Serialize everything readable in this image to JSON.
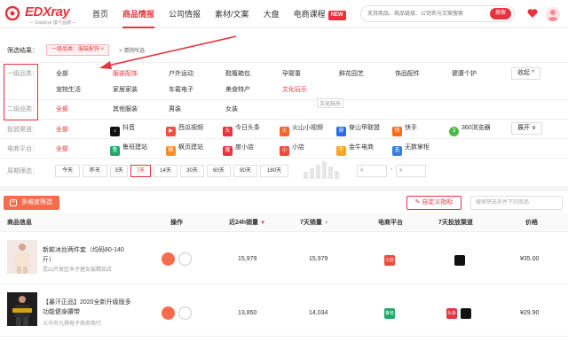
{
  "header": {
    "logo_text": "EDXray",
    "logo_sub": "— DataEye 旗下品牌 —",
    "nav": [
      {
        "label": "首页"
      },
      {
        "label": "商品情报"
      },
      {
        "label": "公司情报"
      },
      {
        "label": "素材/文案"
      },
      {
        "label": "大盘"
      },
      {
        "label": "电商课程"
      }
    ],
    "new_badge": "NEW",
    "search_placeholder": "支持商品、商品链接、公司名与文案搜索",
    "search_button": "搜索"
  },
  "result_bar": {
    "label": "筛选结果：",
    "tag": "一级品类：服装配饰 ×",
    "clear": "× 清除所选"
  },
  "filters": {
    "level1": {
      "label": "一级品类：",
      "row1": [
        "全部",
        "服装配饰",
        "户外运动",
        "鞋履箱包",
        "孕婴童",
        "鲜花园艺",
        "饰品配件",
        "健康个护"
      ],
      "row2": [
        "宠物生活",
        "家居家装",
        "车载电子",
        "美食特产",
        "文化玩乐"
      ],
      "collapse": "收起 ^"
    },
    "level2": {
      "label": "二级品类：",
      "options": [
        "全部",
        "其他服装",
        "男装",
        "女装"
      ],
      "tooltip": "文化玩乐"
    },
    "channel": {
      "label": "投放渠道：",
      "options": [
        "全部",
        "抖音",
        "西瓜视频",
        "今日头条",
        "火山小视频",
        "穿山甲联盟",
        "快手",
        "360浏览器"
      ],
      "expand": "展开 ∨"
    },
    "platform": {
      "label": "电商平台：",
      "options": [
        "全部",
        "鲁班建站",
        "枫页建站",
        "度小店",
        "小店",
        "金牛电商",
        "无数掌柜"
      ]
    },
    "period": {
      "label": "周期筛选：",
      "options": [
        "今天",
        "昨天",
        "3天",
        "7天",
        "14天",
        "30天",
        "60天",
        "90天",
        "180天"
      ],
      "price_symbol_1": "¥",
      "price_symbol_2": "¥",
      "dash": "-"
    }
  },
  "toolbar": {
    "multi_filter": "多维度筛选",
    "custom_metric": "自定义指标",
    "search_placeholder": "搜索筛选条件下的商品"
  },
  "table": {
    "headers": [
      "商品信息",
      "操作",
      "近24h销量",
      "7天销量",
      "电商平台",
      "7天投放渠道",
      "价格"
    ],
    "rows": [
      {
        "name": "新款冰丝两件套（均码80-140斤）",
        "shop": "昆山开发区木子屋女装精品店",
        "sales_24h": "15,979",
        "sales_7d": "15,979",
        "platform": "小店",
        "price": "¥35.00"
      },
      {
        "name": "【暴汗正品】2020全新升级版多功能健身腰带",
        "shop": "义乌市九祺电子商务商行",
        "sales_24h": "13,850",
        "sales_7d": "14,034",
        "platform": "鲁班",
        "channel_badge": "头条",
        "price": "¥29.90"
      }
    ]
  },
  "colors": {
    "brand_red": "#e8333f",
    "orange": "#f86b4d"
  }
}
